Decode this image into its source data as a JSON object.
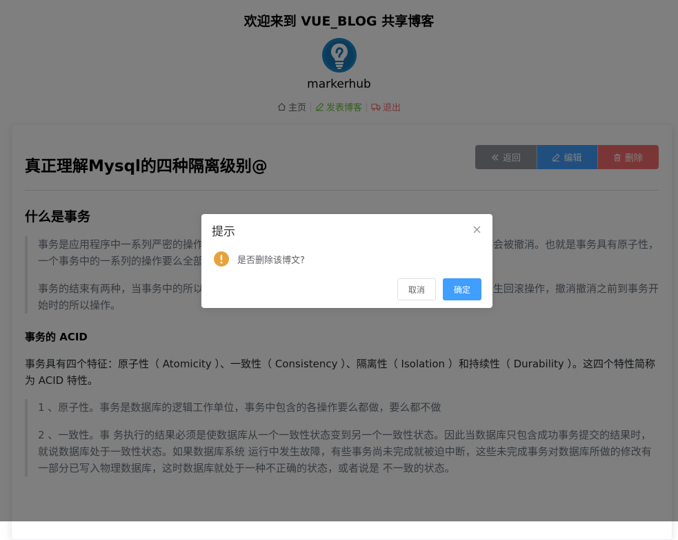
{
  "header": {
    "site_title": "欢迎来到 VUE_BLOG 共享博客",
    "username": "markerhub",
    "nav": {
      "home": "主页",
      "post": "发表博客",
      "logout": "退出"
    }
  },
  "blog": {
    "title": "真正理解Mysql的四种隔离级别@",
    "buttons": {
      "back": "返回",
      "edit": "编辑",
      "delete": "删除"
    },
    "section_heading": "什么是事务",
    "quote_1_p1": "事务是应用程序中一系列严密的操作，所有操作必须成功完成，否则在每个操作中所作的所有更改都会被撤消。也就是事务具有原子性，一个事务中的一系列的操作要么全部成功，要么一个都不做。",
    "quote_1_p2": "事务的结束有两种，当事务中的所以步骤全部成功执行时，事务提交。如果其中一个步骤失败，将发生回滚操作，撤消撤消之前到事务开始时的所以操作。",
    "acid_heading": "事务的 ACID",
    "acid_paragraph": "事务具有四个特征：原子性（ Atomicity ）、一致性（ Consistency ）、隔离性（ Isolation ）和持续性（ Durability ）。这四个特性简称为 ACID 特性。",
    "quote_2_p1": "1 、原子性。事务是数据库的逻辑工作单位，事务中包含的各操作要么都做，要么都不做",
    "quote_2_p2": "2 、一致性。事 务执行的结果必须是使数据库从一个一致性状态变到另一个一致性状态。因此当数据库只包含成功事务提交的结果时，就说数据库处于一致性状态。如果数据库系统 运行中发生故障，有些事务尚未完成就被迫中断，这些未完成事务对数据库所做的修改有一部分已写入物理数据库，这时数据库就处于一种不正确的状态，或者说是 不一致的状态。"
  },
  "dialog": {
    "title": "提示",
    "message": "是否删除该博文?",
    "cancel": "取消",
    "confirm": "确定"
  },
  "colors": {
    "primary": "#409eff",
    "success": "#67c23a",
    "danger": "#f56c6c",
    "info": "#909399",
    "warning": "#e6a23c"
  },
  "icons": {
    "avatar": "lightbulb-avatar",
    "home": "house-icon",
    "post": "pencil-icon",
    "logout": "truck-icon",
    "back": "double-left-icon",
    "edit": "pencil-icon",
    "delete": "trash-icon",
    "close": "close-icon",
    "warning": "warning-icon"
  }
}
